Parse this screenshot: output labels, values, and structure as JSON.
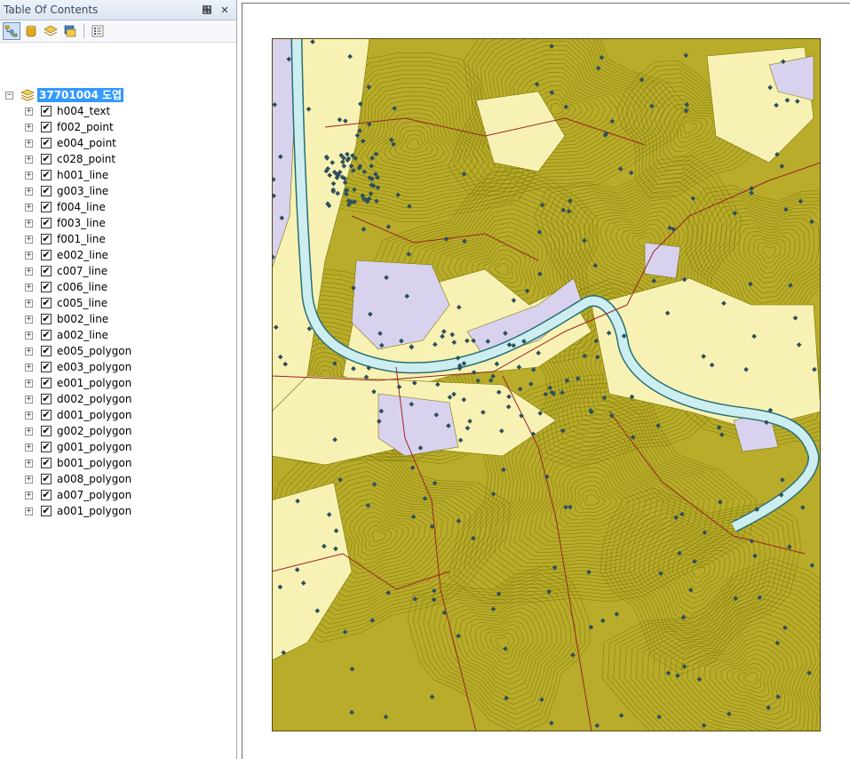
{
  "toc": {
    "title": "Table Of Contents",
    "pin_glyph": "՘",
    "close_glyph": "✕",
    "toolbar": [
      {
        "name": "list-by-drawing-order-icon",
        "active": true
      },
      {
        "name": "list-by-source-icon",
        "active": false
      },
      {
        "name": "list-by-visibility-icon",
        "active": false
      },
      {
        "name": "list-by-selection-icon",
        "active": false
      },
      {
        "name": "options-icon",
        "active": false
      }
    ],
    "root": {
      "label": "37701004 도엽",
      "expander": "−"
    },
    "layers": [
      {
        "name": "h004_text",
        "checked": true
      },
      {
        "name": "f002_point",
        "checked": true
      },
      {
        "name": "e004_point",
        "checked": true
      },
      {
        "name": "c028_point",
        "checked": true
      },
      {
        "name": "h001_line",
        "checked": true
      },
      {
        "name": "g003_line",
        "checked": true
      },
      {
        "name": "f004_line",
        "checked": true
      },
      {
        "name": "f003_line",
        "checked": true
      },
      {
        "name": "f001_line",
        "checked": true
      },
      {
        "name": "e002_line",
        "checked": true
      },
      {
        "name": "c007_line",
        "checked": true
      },
      {
        "name": "c006_line",
        "checked": true
      },
      {
        "name": "c005_line",
        "checked": true
      },
      {
        "name": "b002_line",
        "checked": true
      },
      {
        "name": "a002_line",
        "checked": true
      },
      {
        "name": "e005_polygon",
        "checked": true
      },
      {
        "name": "e003_polygon",
        "checked": true
      },
      {
        "name": "e001_polygon",
        "checked": true
      },
      {
        "name": "d002_polygon",
        "checked": true
      },
      {
        "name": "d001_polygon",
        "checked": true
      },
      {
        "name": "g002_polygon",
        "checked": true
      },
      {
        "name": "g001_polygon",
        "checked": true
      },
      {
        "name": "b001_polygon",
        "checked": true
      },
      {
        "name": "a008_polygon",
        "checked": true
      },
      {
        "name": "a007_polygon",
        "checked": true
      },
      {
        "name": "a001_polygon",
        "checked": true
      }
    ],
    "expander_glyph": "+",
    "check_glyph": "✔"
  },
  "map": {
    "colors": {
      "terrain": "#b8ac2a",
      "contour": "#7c7408",
      "lowland": "#f7f2b4",
      "urban": "#d8d2ee",
      "river": "#cdeef0",
      "river_edge": "#2a6e74",
      "road": "#9a2424",
      "point": "#2e4f5c",
      "border": "#5a4a10"
    }
  }
}
